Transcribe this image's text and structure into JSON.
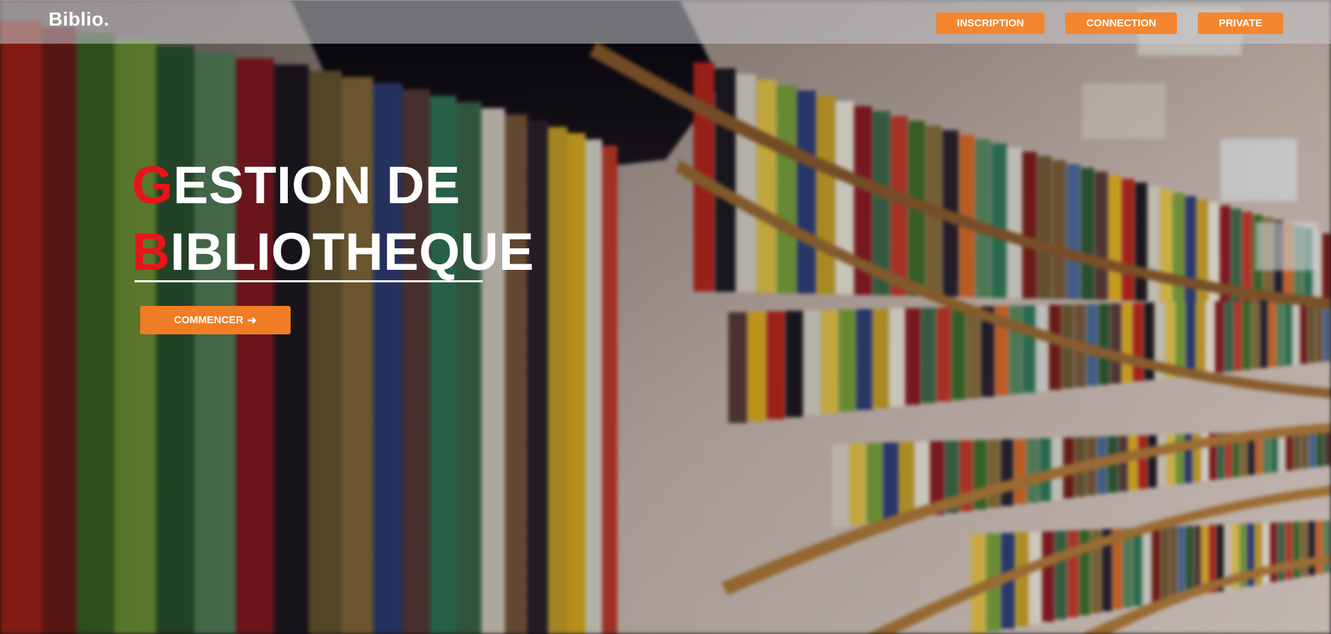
{
  "brand": {
    "logo": "Biblio."
  },
  "nav": {
    "inscription": "INSCRIPTION",
    "connection": "CONNECTION",
    "private": "PRIVATE"
  },
  "hero": {
    "line1_initial": "G",
    "line1_rest": "ESTION DE",
    "line2_initial": "B",
    "line2_rest": "IBLIOTHEQUE",
    "cta_label": "COMMENCER",
    "cta_icon": "arrow-right-icon"
  },
  "colors": {
    "accent": "#f3862e",
    "initial_letters": "#e8141a",
    "text": "#ffffff",
    "navbar": "#c8c8cd"
  }
}
